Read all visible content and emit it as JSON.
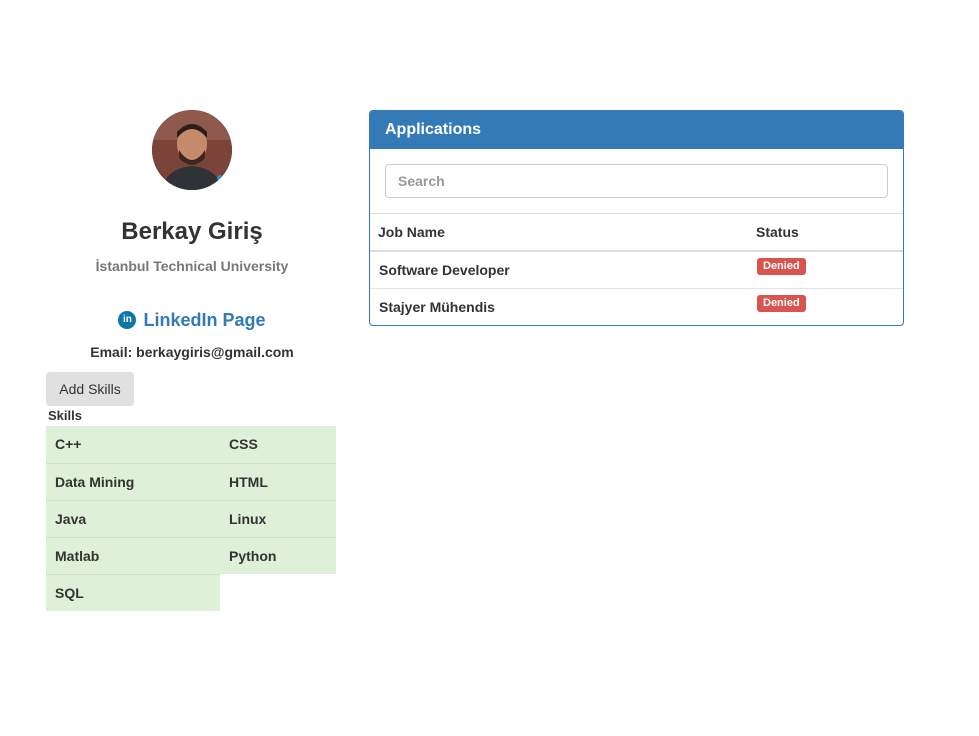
{
  "profile": {
    "name": "Berkay Giriş",
    "university": "İstanbul Technical University",
    "linkedin_icon": "linkedin-icon",
    "linkedin_icon_glyph": "in",
    "linkedin_label": "LinkedIn Page",
    "email_line": "Email: berkaygiris@gmail.com",
    "add_skills_label": "Add Skills",
    "skills_title": "Skills",
    "skills": [
      "C++",
      "CSS",
      "Data Mining",
      "HTML",
      "Java",
      "Linux",
      "Matlab",
      "Python",
      "SQL"
    ]
  },
  "applications": {
    "title": "Applications",
    "search_placeholder": "Search",
    "columns": {
      "job_name": "Job Name",
      "status": "Status"
    },
    "rows": [
      {
        "job": "Software Developer",
        "status": "Denied"
      },
      {
        "job": "Stajyer Mühendis",
        "status": "Denied"
      }
    ]
  },
  "colors": {
    "primary": "#337ab7",
    "danger": "#d9534f",
    "skill_bg": "#dff0d8",
    "button_bg": "#e0e0e0"
  }
}
